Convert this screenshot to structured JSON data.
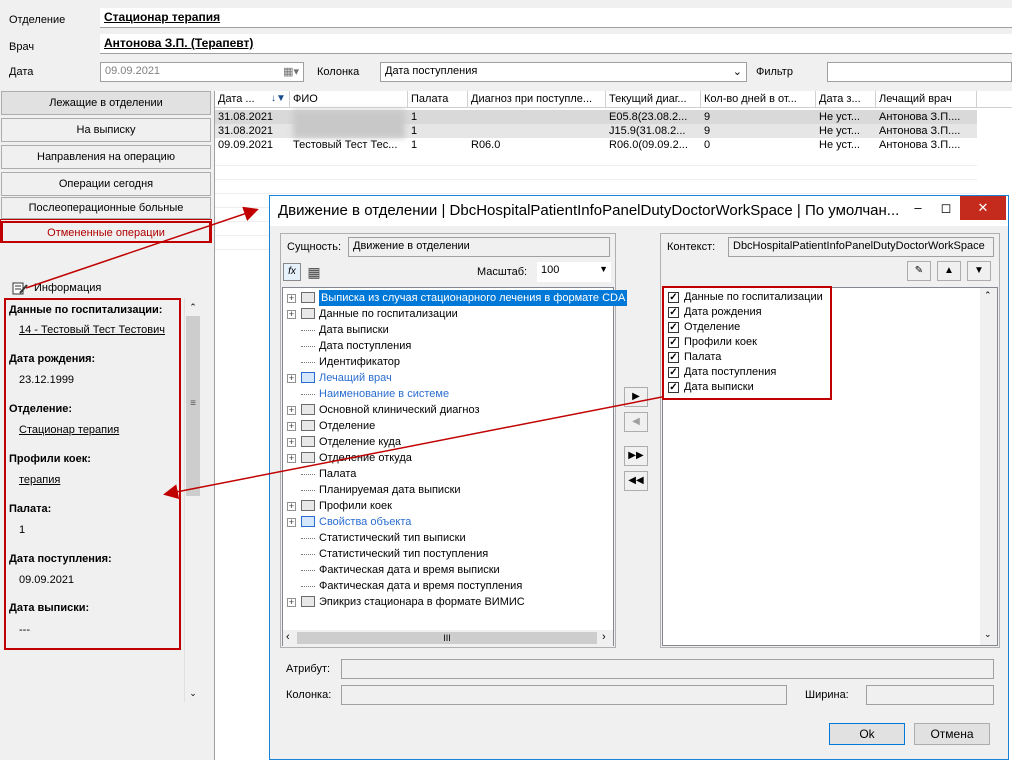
{
  "header": {
    "department_label": "Отделение",
    "department_value": "Стационар терапия",
    "doctor_label": "Врач",
    "doctor_value": "Антонова З.П. (Терапевт)",
    "date_label": "Дата",
    "date_value": "09.09.2021",
    "column_label": "Колонка",
    "column_value": "Дата поступления",
    "filter_label": "Фильтр",
    "filter_value": ""
  },
  "nav": {
    "items": [
      {
        "label": "Лежащие в отделении"
      },
      {
        "label": "На выписку"
      },
      {
        "label": "Направления на операцию"
      },
      {
        "label": "Операции сегодня"
      },
      {
        "label": "Послеоперационные больные"
      },
      {
        "label": "Отмененные операции"
      }
    ]
  },
  "grid": {
    "columns": [
      "Дата ...",
      "ФИО",
      "Палата",
      "Диагноз при поступле...",
      "Текущий диаг...",
      "Кол-во дней в от...",
      "Дата з...",
      "Лечащий врач"
    ],
    "rows": [
      [
        "31.08.2021",
        "",
        "1",
        "",
        "E05.8(23.08.2...",
        "9",
        "Не уст...",
        "Антонова З.П...."
      ],
      [
        "31.08.2021",
        "",
        "1",
        "",
        "J15.9(31.08.2...",
        "9",
        "Не уст...",
        "Антонова З.П...."
      ],
      [
        "09.09.2021",
        "Тестовый Тест Тес...",
        "1",
        "R06.0",
        "R06.0(09.09.2...",
        "0",
        "Не уст...",
        "Антонова З.П...."
      ]
    ]
  },
  "info": {
    "title": "Информация",
    "fields": [
      {
        "key": "Данные по госпитализации:",
        "value": "14 - Тестовый Тест Тестович"
      },
      {
        "key": "Дата рождения:",
        "value": "23.12.1999"
      },
      {
        "key": "Отделение:",
        "value": "Стационар терапия"
      },
      {
        "key": "Профили коек:",
        "value": "терапия"
      },
      {
        "key": "Палата:",
        "value": "1"
      },
      {
        "key": "Дата поступления:",
        "value": "09.09.2021"
      },
      {
        "key": "Дата выписки:",
        "value": "---"
      }
    ]
  },
  "dialog": {
    "title": "Движение в отделении | DbcHospitalPatientInfoPanelDutyDoctorWorkSpace | По умолчан...",
    "entity_label": "Сущность:",
    "entity_value": "Движение в отделении",
    "scale_label": "Масштаб:",
    "scale_value": "100",
    "context_label": "Контекст:",
    "context_value": "DbcHospitalPatientInfoPanelDutyDoctorWorkSpace",
    "tree": [
      {
        "label": "Выписка из случая стационарного лечения в формате CDA"
      },
      {
        "label": "Данные по госпитализации"
      },
      {
        "label": "Дата выписки"
      },
      {
        "label": "Дата поступления"
      },
      {
        "label": "Идентификатор"
      },
      {
        "label": "Лечащий врач"
      },
      {
        "label": "Наименование в системе"
      },
      {
        "label": "Основной клинический диагноз"
      },
      {
        "label": "Отделение"
      },
      {
        "label": "Отделение куда"
      },
      {
        "label": "Отделение откуда"
      },
      {
        "label": "Палата"
      },
      {
        "label": "Планируемая дата выписки"
      },
      {
        "label": "Профили коек"
      },
      {
        "label": "Свойства объекта"
      },
      {
        "label": "Статистический тип выписки"
      },
      {
        "label": "Статистический тип поступления"
      },
      {
        "label": "Фактическая дата и время выписки"
      },
      {
        "label": "Фактическая дата и время поступления"
      },
      {
        "label": "Эпикриз стационара в формате ВИМИС"
      }
    ],
    "selected": [
      {
        "label": "Данные по госпитализации"
      },
      {
        "label": "Дата рождения"
      },
      {
        "label": "Отделение"
      },
      {
        "label": "Профили коек"
      },
      {
        "label": "Палата"
      },
      {
        "label": "Дата поступления"
      },
      {
        "label": "Дата выписки"
      }
    ],
    "attribute_label": "Атрибут:",
    "column_label": "Колонка:",
    "width_label": "Ширина:",
    "ok_label": "Ok",
    "cancel_label": "Отмена",
    "hscroll_glyph": "III"
  },
  "colors": {
    "accent": "#0078d7",
    "annotation": "#c00000",
    "link_blue": "#2a6dd0",
    "close_red": "#c42b1c"
  }
}
